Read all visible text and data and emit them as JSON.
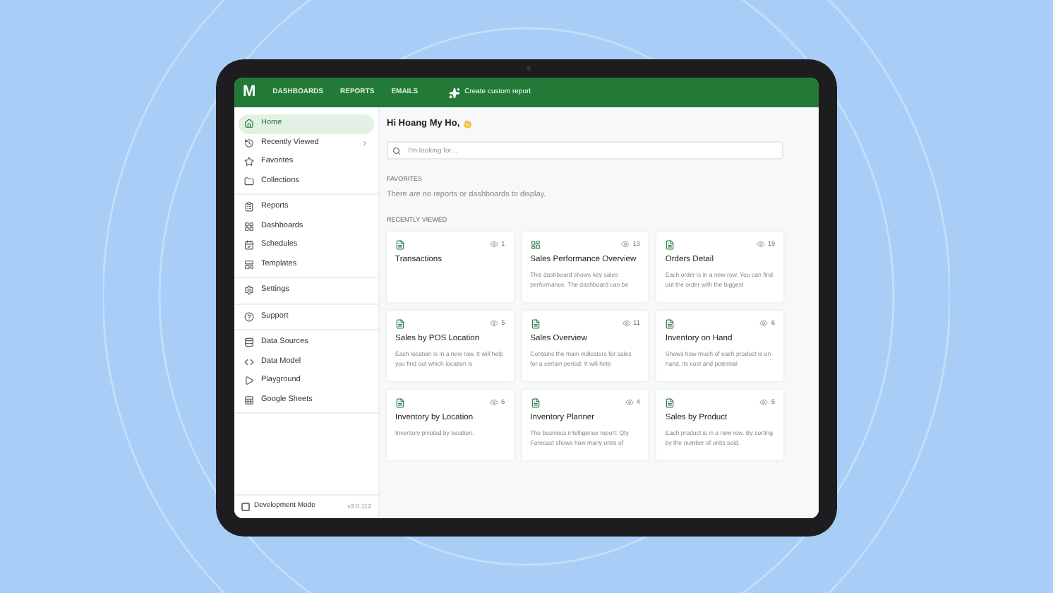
{
  "topbar": {
    "logo": "M",
    "nav": [
      {
        "label": "DASHBOARDS",
        "selected": false
      },
      {
        "label": "REPORTS",
        "selected": false
      },
      {
        "label": "EMAILS",
        "selected": false
      }
    ],
    "create_button": "Create custom report"
  },
  "sidebar": {
    "groups": [
      [
        {
          "label": "Home",
          "selected": true,
          "has_submenu": false
        },
        {
          "label": "Recently Viewed",
          "selected": false,
          "has_submenu": true
        },
        {
          "label": "Favorites",
          "selected": false,
          "has_submenu": false
        },
        {
          "label": "Collections",
          "selected": false,
          "has_submenu": false
        }
      ],
      [
        {
          "label": "Reports",
          "selected": false,
          "has_submenu": false
        },
        {
          "label": "Dashboards",
          "selected": false,
          "has_submenu": false
        },
        {
          "label": "Schedules",
          "selected": false,
          "has_submenu": false
        },
        {
          "label": "Templates",
          "selected": false,
          "has_submenu": false
        }
      ],
      [
        {
          "label": "Settings",
          "selected": false,
          "has_submenu": false
        }
      ],
      [
        {
          "label": "Support",
          "selected": false,
          "has_submenu": false
        }
      ],
      [
        {
          "label": "Data Sources",
          "selected": false,
          "has_submenu": false
        },
        {
          "label": "Data Model",
          "selected": false,
          "has_submenu": false
        },
        {
          "label": "Playground",
          "selected": false,
          "has_submenu": false
        },
        {
          "label": "Google Sheets",
          "selected": false,
          "has_submenu": false
        }
      ]
    ],
    "dev_mode": {
      "label": "Development Mode",
      "checked": false
    },
    "version": "v3.0.112"
  },
  "main": {
    "greeting": "Hi Hoang My Ho,",
    "search": {
      "placeholder": "I'm looking for..."
    },
    "favorites": {
      "heading": "FAVORITES",
      "empty_text": "There are no reports or dashboards to display."
    },
    "recently_viewed": {
      "heading": "RECENTLY VIEWED",
      "cards": [
        {
          "kind": "report",
          "views": "1",
          "title": "Transactions"
        },
        {
          "kind": "dashboard",
          "views": "13",
          "title": "Sales Performance Overview",
          "description": "This dashboard shows key sales performance. The dashboard can be"
        },
        {
          "kind": "report",
          "views": "19",
          "title": "Orders Detail",
          "description": "Each order is in a new row. You can find out the order with the biggest"
        },
        {
          "kind": "report",
          "views": "5",
          "title": "Sales by POS Location",
          "description": "Each location is in a new row. It will help you find out which location is"
        },
        {
          "kind": "report",
          "views": "11",
          "title": "Sales Overview",
          "description": "Contains the main indicators for sales for a certain period. It will help"
        },
        {
          "kind": "report",
          "views": "6",
          "title": "Inventory on Hand",
          "description": "Shows how much of each product is on hand, its cost and potential"
        },
        {
          "kind": "report",
          "views": "6",
          "title": "Inventory by Location",
          "description": "Inventory pivoted by location."
        },
        {
          "kind": "report",
          "views": "4",
          "title": "Inventory Planner",
          "description": "The business intelligence report: Qty Forecast shows how many units of"
        },
        {
          "kind": "report",
          "views": "5",
          "title": "Sales by Product",
          "description": "Each product is in a new row. By sorting by the number of units sold,"
        }
      ]
    }
  }
}
